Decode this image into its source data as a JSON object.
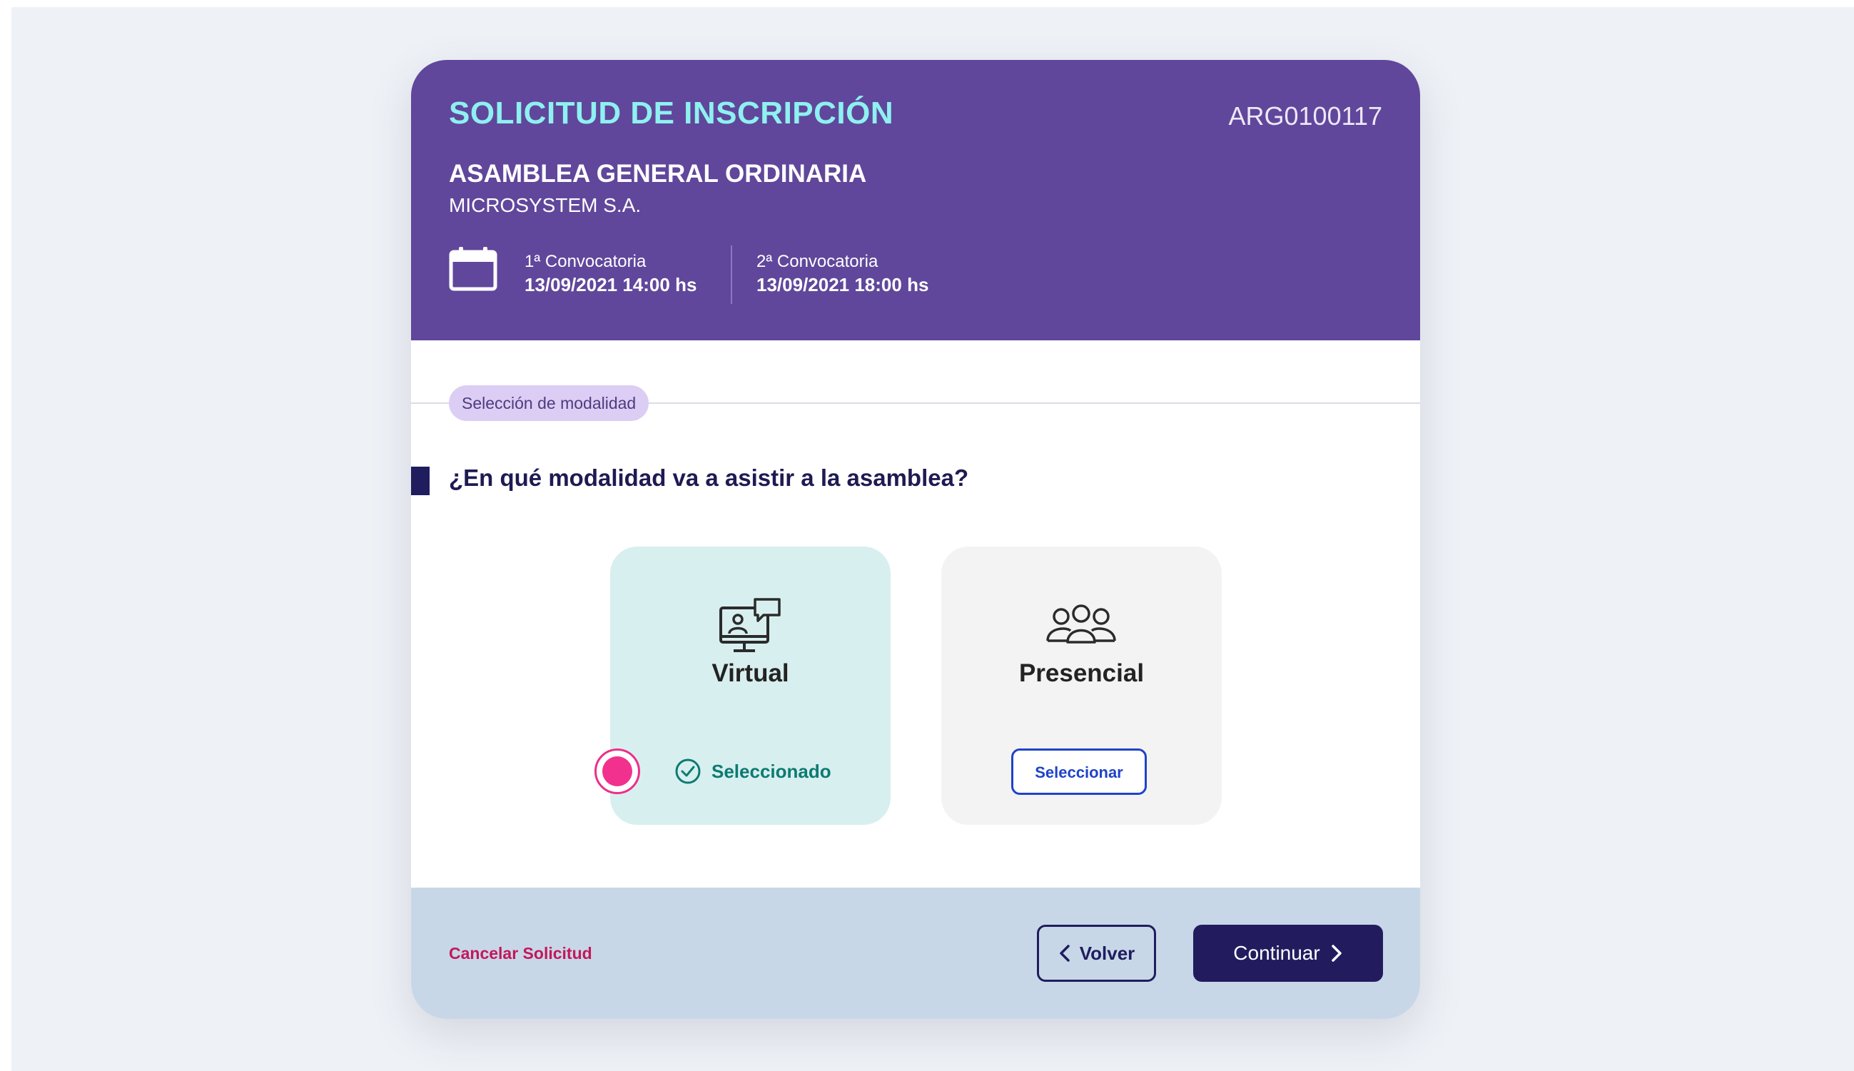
{
  "header": {
    "title": "SOLICITUD DE INSCRIPCIÓN",
    "code": "ARG0100117",
    "event": "ASAMBLEA GENERAL ORDINARIA",
    "company": "MICROSYSTEM S.A.",
    "convocatoria_1": {
      "label": "1ª Convocatoria",
      "date": "13/09/2021 14:00 hs"
    },
    "convocatoria_2": {
      "label": "2ª Convocatoria",
      "date": "13/09/2021 18:00 hs"
    }
  },
  "step": {
    "label": "Selección de modalidad"
  },
  "question": "¿En qué modalidad va a asistir a la asamblea?",
  "options": {
    "virtual": {
      "title": "Virtual",
      "status": "Seleccionado",
      "selected": true,
      "icon": "computer-chat-icon"
    },
    "presencial": {
      "title": "Presencial",
      "button": "Seleccionar",
      "selected": false,
      "icon": "people-group-icon"
    }
  },
  "footer": {
    "cancel": "Cancelar Solicitud",
    "back": "Volver",
    "next": "Continuar"
  },
  "colors": {
    "header_bg": "#60479b",
    "title_accent": "#8ff0f0",
    "selected_bg": "#d8efef",
    "selected_text": "#0d7a72",
    "primary_dark": "#221c5f",
    "cancel": "#c2185b",
    "footer_bg": "#c8d7e7"
  }
}
